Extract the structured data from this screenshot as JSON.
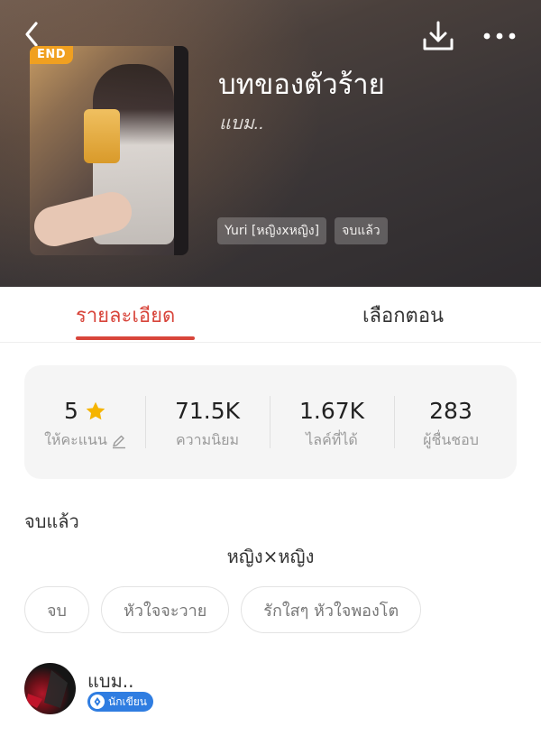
{
  "header": {
    "title": "บทของตัวร้าย",
    "author": "แบม..",
    "badge": "END",
    "tags": [
      "Yuri [หญิงxหญิง]",
      "จบแล้ว"
    ],
    "icons": [
      "back-icon",
      "download-icon",
      "more-icon"
    ]
  },
  "tabs": [
    {
      "label": "รายละเอียด",
      "active": true
    },
    {
      "label": "เลือกตอน",
      "active": false
    }
  ],
  "stats": [
    {
      "value": "5",
      "label": "ให้คะแนน",
      "icon": "star-icon",
      "label_icon": "edit-icon"
    },
    {
      "value": "71.5K",
      "label": "ความนิยม"
    },
    {
      "value": "1.67K",
      "label": "ไลค์ที่ได้"
    },
    {
      "value": "283",
      "label": "ผู้ชื่นชอบ"
    }
  ],
  "status": "จบแล้ว",
  "genre": "หญิง×หญิง",
  "chips": [
    "จบ",
    "หัวใจจะวาย",
    "รักใสๆ หัวใจพองโต"
  ],
  "author_section": {
    "name": "แบม..",
    "badge": "นักเขียน"
  },
  "colors": {
    "accent": "#d8453b",
    "end_badge": "#f0a020",
    "star": "#f5b400",
    "writer_badge": "#2f7de1"
  }
}
